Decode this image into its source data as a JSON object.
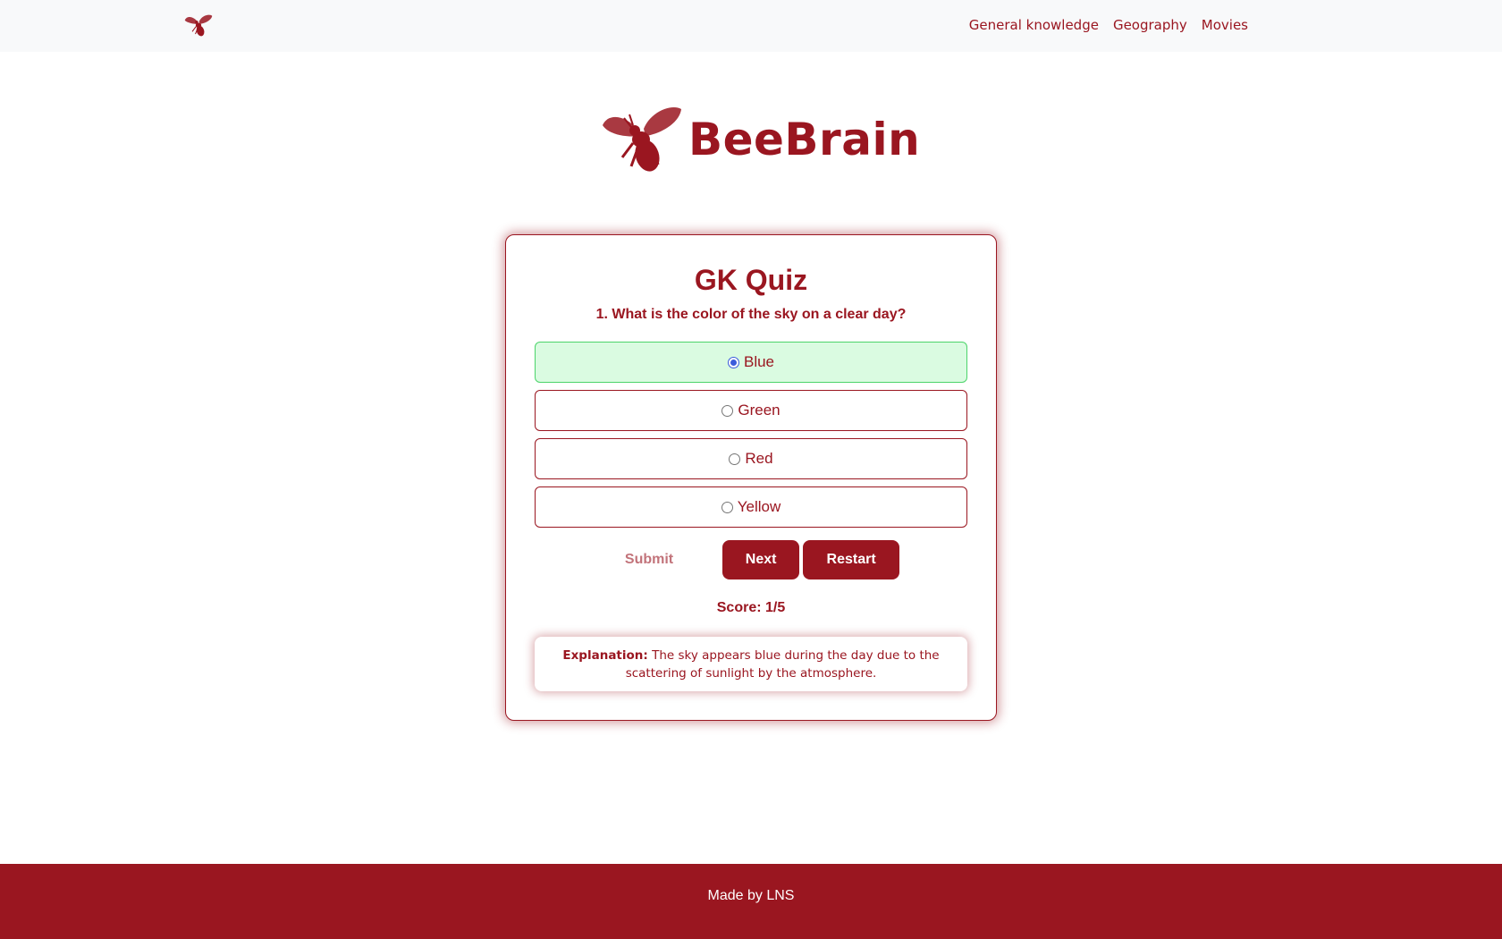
{
  "nav": {
    "logo_icon": "bee-icon",
    "links": [
      "General knowledge",
      "Geography",
      "Movies"
    ]
  },
  "brand": {
    "logo_icon": "bee-icon",
    "name": "BeeBrain"
  },
  "quiz": {
    "title": "GK Quiz",
    "question": "1. What is the color of the sky on a clear day?",
    "options": [
      {
        "label": "Blue",
        "selected": true
      },
      {
        "label": "Green",
        "selected": false
      },
      {
        "label": "Red",
        "selected": false
      },
      {
        "label": "Yellow",
        "selected": false
      }
    ],
    "buttons": {
      "submit": "Submit",
      "next": "Next",
      "restart": "Restart"
    },
    "score": "Score: 1/5",
    "explanation": {
      "label": "Explanation:",
      "text": " The sky appears blue during the day due to the scattering of sunlight by the atmosphere."
    }
  },
  "footer": {
    "text": "Made by LNS"
  },
  "colors": {
    "brand": "#9a1620",
    "correct_bg": "#dafbe1",
    "correct_border": "#4cd46a"
  }
}
